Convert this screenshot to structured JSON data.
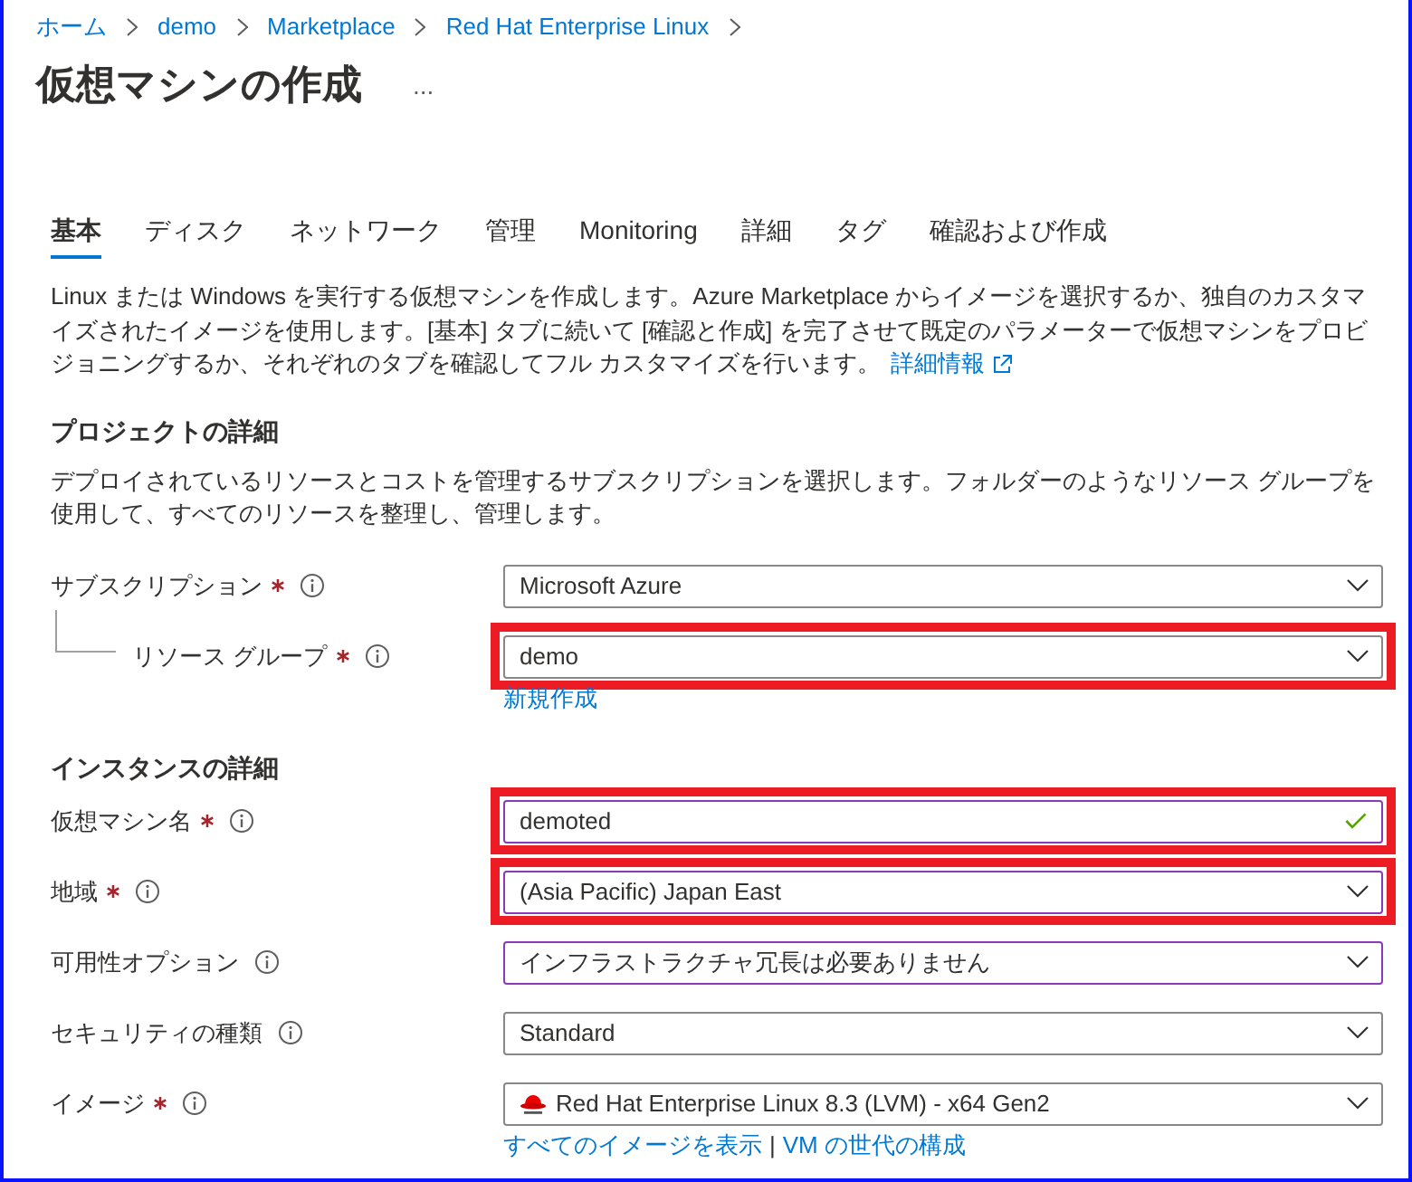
{
  "breadcrumb": [
    "ホーム",
    "demo",
    "Marketplace",
    "Red Hat Enterprise Linux"
  ],
  "page_title": "仮想マシンの作成",
  "more_button": "...",
  "tabs": [
    {
      "label": "基本",
      "selected": true
    },
    {
      "label": "ディスク",
      "selected": false
    },
    {
      "label": "ネットワーク",
      "selected": false
    },
    {
      "label": "管理",
      "selected": false
    },
    {
      "label": "Monitoring",
      "selected": false
    },
    {
      "label": "詳細",
      "selected": false
    },
    {
      "label": "タグ",
      "selected": false
    },
    {
      "label": "確認および作成",
      "selected": false
    }
  ],
  "intro": {
    "text": "Linux または Windows を実行する仮想マシンを作成します。Azure Marketplace からイメージを選択するか、独自のカスタマイズされたイメージを使用します。[基本] タブに続いて [確認と作成] を完了させて既定のパラメーターで仮想マシンをプロビジョニングするか、それぞれのタブを確認してフル カスタマイズを行います。",
    "link": "詳細情報"
  },
  "sections": [
    {
      "heading": "プロジェクトの詳細",
      "description": "デプロイされているリソースとコストを管理するサブスクリプションを選択します。フォルダーのようなリソース グループを使用して、すべてのリソースを整理し、管理します。",
      "fields": [
        {
          "label": "サブスクリプション",
          "required": true,
          "kind": "dropdown",
          "value": "Microsoft Azure",
          "focused": false,
          "highlighted": false,
          "children": [
            {
              "label": "リソース グループ",
              "required": true,
              "kind": "dropdown",
              "value": "demo",
              "focused": false,
              "highlighted": true,
              "links": [
                "新規作成"
              ]
            }
          ]
        }
      ]
    },
    {
      "heading": "インスタンスの詳細",
      "fields": [
        {
          "label": "仮想マシン名",
          "required": true,
          "kind": "text",
          "value": "demoted",
          "valid": true,
          "focused": true,
          "highlighted": true
        },
        {
          "label": "地域",
          "required": true,
          "kind": "dropdown",
          "value": "(Asia Pacific) Japan East",
          "focused": true,
          "highlighted": true
        },
        {
          "label": "可用性オプション",
          "required": false,
          "kind": "dropdown",
          "value": "インフラストラクチャ冗長は必要ありません",
          "focused": true,
          "highlighted": false
        },
        {
          "label": "セキュリティの種類",
          "required": false,
          "kind": "dropdown",
          "value": "Standard",
          "focused": false,
          "highlighted": false
        },
        {
          "label": "イメージ",
          "required": true,
          "kind": "dropdown",
          "value": "Red Hat Enterprise Linux 8.3 (LVM) - x64 Gen2",
          "logo": true,
          "focused": false,
          "highlighted": false,
          "links": [
            "すべてのイメージを表示",
            "VM の世代の構成"
          ],
          "link_separator": "|"
        }
      ]
    }
  ]
}
